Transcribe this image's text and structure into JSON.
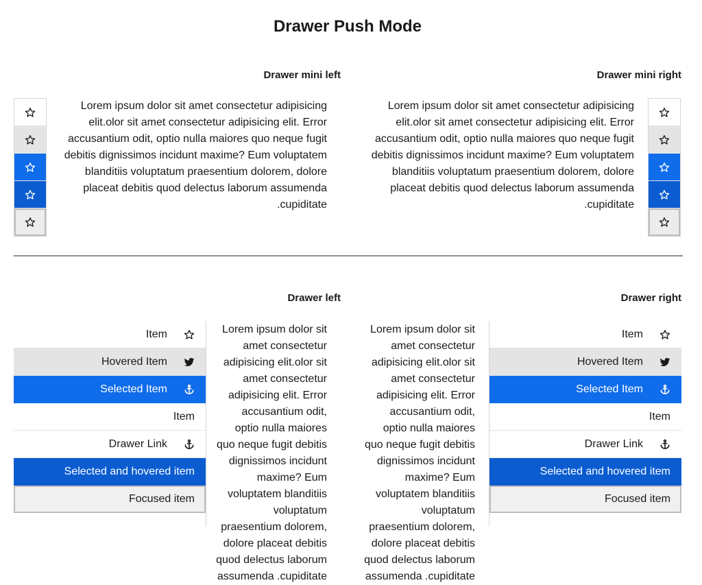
{
  "page": {
    "title": "Drawer Push Mode"
  },
  "mini_left": {
    "title": "Drawer mini left"
  },
  "mini_right": {
    "title": "Drawer mini right"
  },
  "drawer_left": {
    "title": "Drawer left"
  },
  "drawer_right": {
    "title": "Drawer right"
  },
  "lorem": "Lorem ipsum dolor sit amet consectetur adipisicing elit.olor sit amet consectetur adipisicing elit. Error accusantium odit, optio nulla maiores quo neque fugit debitis dignissimos incidunt maxime? Eum voluptatem blanditiis voluptatum praesentium dolorem, dolore placeat debitis quod delectus laborum assumenda .cupiditate",
  "drawer_items": [
    {
      "label": "Item",
      "icon": "star-icon",
      "state": "normal"
    },
    {
      "label": "Hovered Item",
      "icon": "twitter-icon",
      "state": "hovered"
    },
    {
      "label": "Selected Item",
      "icon": "anchor-icon",
      "state": "selected"
    },
    {
      "label": "Item",
      "icon": "",
      "state": "normal"
    },
    {
      "label": "Drawer Link",
      "icon": "anchor-icon",
      "state": "normal"
    },
    {
      "label": "Selected and hovered item",
      "icon": "",
      "state": "selected-hovered"
    },
    {
      "label": "Focused item",
      "icon": "",
      "state": "focused"
    }
  ],
  "mini_items": [
    {
      "icon": "star-icon",
      "state": "normal"
    },
    {
      "icon": "star-icon",
      "state": "hovered"
    },
    {
      "icon": "star-icon",
      "state": "selected"
    },
    {
      "icon": "star-icon",
      "state": "selected-hovered"
    },
    {
      "icon": "star-icon",
      "state": "focused"
    }
  ],
  "colors": {
    "selected": "#0f6cea",
    "selected_hovered": "#0b5cd0",
    "hovered": "#e4e4e4"
  }
}
